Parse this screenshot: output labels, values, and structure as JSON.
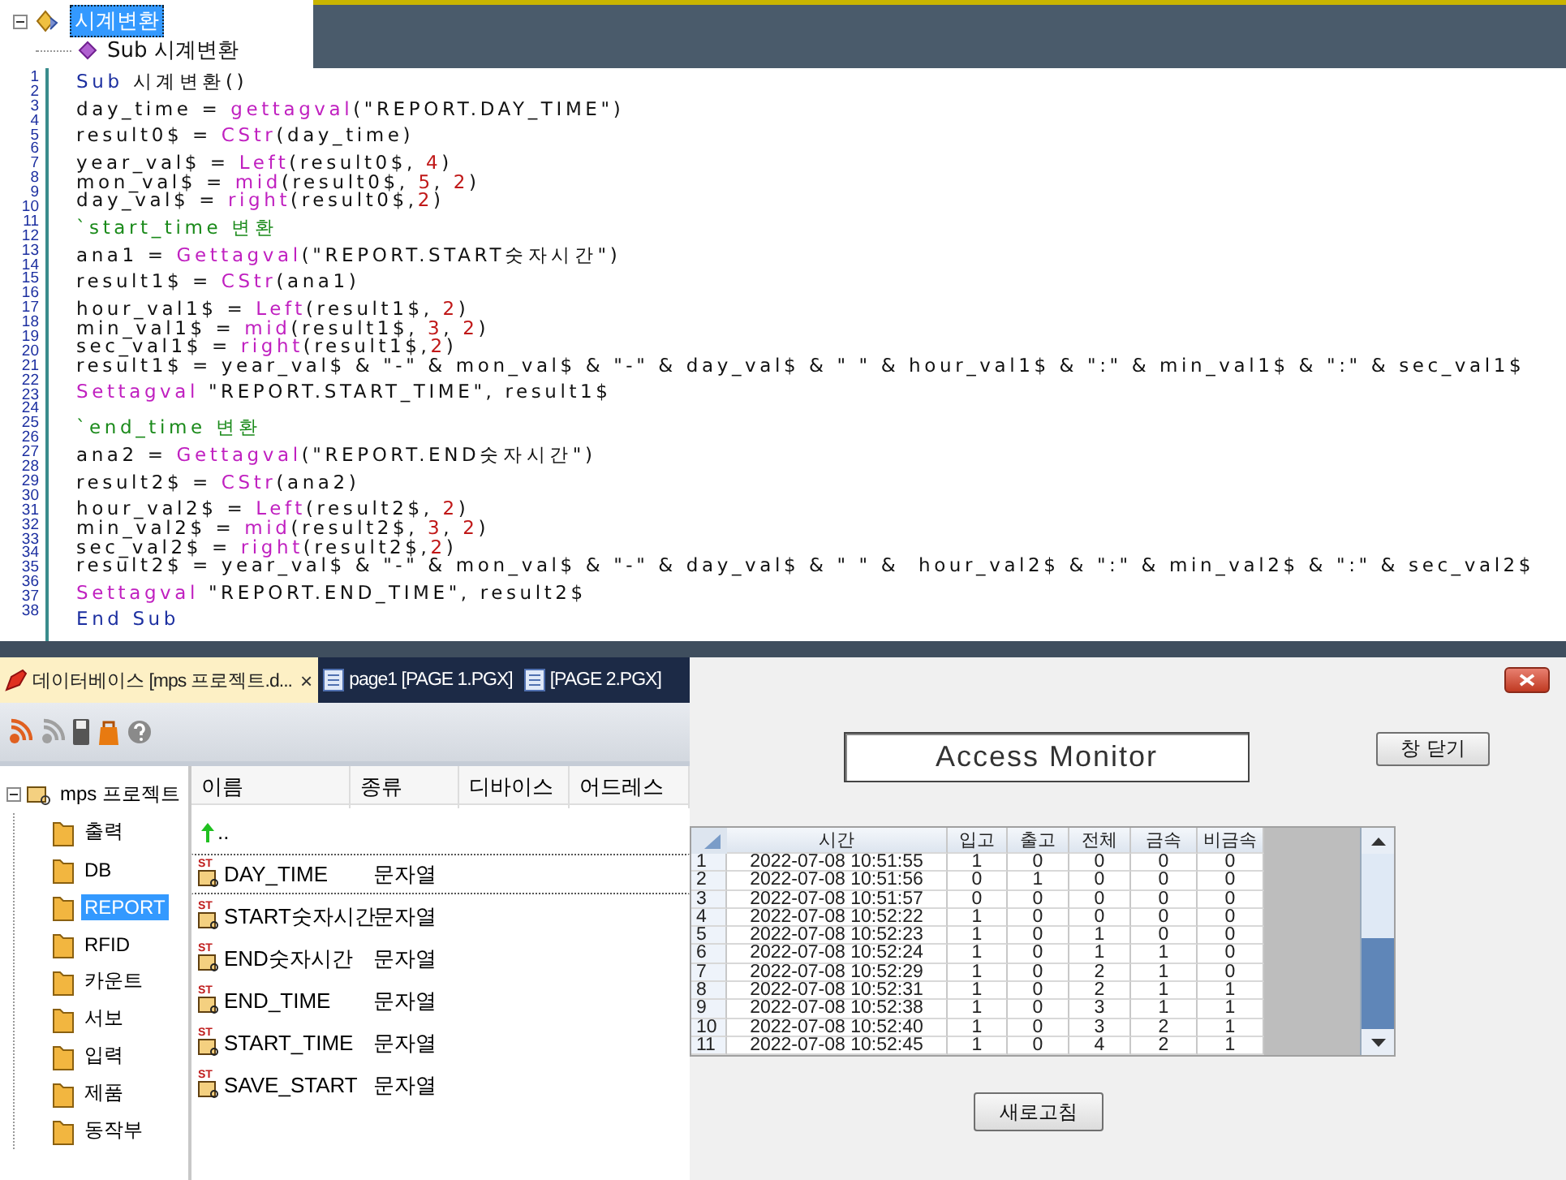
{
  "outline": {
    "items": [
      {
        "label": "시계변환",
        "selected": true,
        "expanded": true,
        "children": [
          {
            "label": "Sub 시계변환",
            "selected": false
          }
        ]
      }
    ]
  },
  "code": {
    "lines": [
      {
        "number": "1",
        "segments": [
          {
            "kind": "keyword",
            "text": "Sub"
          },
          {
            "kind": "plain",
            "text": " 시계변환()"
          }
        ]
      },
      {
        "number": "2"
      },
      {
        "number": "3",
        "segments": [
          {
            "kind": "plain",
            "text": "day_time = "
          },
          {
            "kind": "function",
            "text": "gettagval"
          },
          {
            "kind": "plain",
            "text": "(\"REPORT.DAY_TIME\")"
          }
        ]
      },
      {
        "number": "4"
      },
      {
        "number": "5",
        "segments": [
          {
            "kind": "plain",
            "text": "result0$ = "
          },
          {
            "kind": "function",
            "text": "CStr"
          },
          {
            "kind": "plain",
            "text": "(day_time)"
          }
        ]
      },
      {
        "number": "6"
      },
      {
        "number": "7",
        "segments": [
          {
            "kind": "plain",
            "text": "year_val$ = "
          },
          {
            "kind": "function",
            "text": "Left"
          },
          {
            "kind": "plain",
            "text": "(result0$, "
          },
          {
            "kind": "number",
            "text": "4"
          },
          {
            "kind": "plain",
            "text": ")"
          }
        ]
      },
      {
        "number": "8",
        "segments": [
          {
            "kind": "plain",
            "text": "mon_val$ = "
          },
          {
            "kind": "function",
            "text": "mid"
          },
          {
            "kind": "plain",
            "text": "(result0$, "
          },
          {
            "kind": "number",
            "text": "5"
          },
          {
            "kind": "plain",
            "text": ", "
          },
          {
            "kind": "number",
            "text": "2"
          },
          {
            "kind": "plain",
            "text": ")"
          }
        ]
      },
      {
        "number": "9",
        "segments": [
          {
            "kind": "plain",
            "text": "day_val$ = "
          },
          {
            "kind": "function",
            "text": "right"
          },
          {
            "kind": "plain",
            "text": "(result0$,"
          },
          {
            "kind": "number",
            "text": "2"
          },
          {
            "kind": "plain",
            "text": ")"
          }
        ]
      },
      {
        "number": "10"
      },
      {
        "number": "11",
        "segments": [
          {
            "kind": "comment",
            "text": "`start_time 변환"
          }
        ]
      },
      {
        "number": "12"
      },
      {
        "number": "13",
        "segments": [
          {
            "kind": "plain",
            "text": "ana1 = "
          },
          {
            "kind": "function",
            "text": "Gettagval"
          },
          {
            "kind": "plain",
            "text": "(\"REPORT.START숫자시간\")"
          }
        ]
      },
      {
        "number": "14"
      },
      {
        "number": "15",
        "segments": [
          {
            "kind": "plain",
            "text": "result1$ = "
          },
          {
            "kind": "function",
            "text": "CStr"
          },
          {
            "kind": "plain",
            "text": "(ana1)"
          }
        ]
      },
      {
        "number": "16"
      },
      {
        "number": "17",
        "segments": [
          {
            "kind": "plain",
            "text": "hour_val1$ = "
          },
          {
            "kind": "function",
            "text": "Left"
          },
          {
            "kind": "plain",
            "text": "(result1$, "
          },
          {
            "kind": "number",
            "text": "2"
          },
          {
            "kind": "plain",
            "text": ")"
          }
        ]
      },
      {
        "number": "18",
        "segments": [
          {
            "kind": "plain",
            "text": "min_val1$ = "
          },
          {
            "kind": "function",
            "text": "mid"
          },
          {
            "kind": "plain",
            "text": "(result1$, "
          },
          {
            "kind": "number",
            "text": "3"
          },
          {
            "kind": "plain",
            "text": ", "
          },
          {
            "kind": "number",
            "text": "2"
          },
          {
            "kind": "plain",
            "text": ")"
          }
        ]
      },
      {
        "number": "19",
        "segments": [
          {
            "kind": "plain",
            "text": "sec_val1$ = "
          },
          {
            "kind": "function",
            "text": "right"
          },
          {
            "kind": "plain",
            "text": "(result1$,"
          },
          {
            "kind": "number",
            "text": "2"
          },
          {
            "kind": "plain",
            "text": ")"
          }
        ]
      },
      {
        "number": "20",
        "segments": [
          {
            "kind": "plain",
            "text": "result1$ = year_val$ & \"-\" & mon_val$ & \"-\" & day_val$ & \" \" & hour_val1$ & \":\" & min_val1$ & \":\" & sec_val1$"
          }
        ]
      },
      {
        "number": "21"
      },
      {
        "number": "22",
        "segments": [
          {
            "kind": "function",
            "text": "Settagval"
          },
          {
            "kind": "plain",
            "text": " \"REPORT.START_TIME\", result1$"
          }
        ]
      },
      {
        "number": "23"
      },
      {
        "number": "24"
      },
      {
        "number": "25",
        "segments": [
          {
            "kind": "comment",
            "text": "`end_time 변환"
          }
        ]
      },
      {
        "number": "26"
      },
      {
        "number": "27",
        "segments": [
          {
            "kind": "plain",
            "text": "ana2 = "
          },
          {
            "kind": "function",
            "text": "Gettagval"
          },
          {
            "kind": "plain",
            "text": "(\"REPORT.END숫자시간\")"
          }
        ]
      },
      {
        "number": "28"
      },
      {
        "number": "29",
        "segments": [
          {
            "kind": "plain",
            "text": "result2$ = "
          },
          {
            "kind": "function",
            "text": "CStr"
          },
          {
            "kind": "plain",
            "text": "(ana2)"
          }
        ]
      },
      {
        "number": "30"
      },
      {
        "number": "31",
        "segments": [
          {
            "kind": "plain",
            "text": "hour_val2$ = "
          },
          {
            "kind": "function",
            "text": "Left"
          },
          {
            "kind": "plain",
            "text": "(result2$, "
          },
          {
            "kind": "number",
            "text": "2"
          },
          {
            "kind": "plain",
            "text": ")"
          }
        ]
      },
      {
        "number": "32",
        "segments": [
          {
            "kind": "plain",
            "text": "min_val2$ = "
          },
          {
            "kind": "function",
            "text": "mid"
          },
          {
            "kind": "plain",
            "text": "(result2$, "
          },
          {
            "kind": "number",
            "text": "3"
          },
          {
            "kind": "plain",
            "text": ", "
          },
          {
            "kind": "number",
            "text": "2"
          },
          {
            "kind": "plain",
            "text": ")"
          }
        ]
      },
      {
        "number": "33",
        "segments": [
          {
            "kind": "plain",
            "text": "sec_val2$ = "
          },
          {
            "kind": "function",
            "text": "right"
          },
          {
            "kind": "plain",
            "text": "(result2$,"
          },
          {
            "kind": "number",
            "text": "2"
          },
          {
            "kind": "plain",
            "text": ")"
          }
        ]
      },
      {
        "number": "34",
        "segments": [
          {
            "kind": "plain",
            "text": "result2$ = year_val$ & \"-\" & mon_val$ & \"-\" & day_val$ & \" \" &  hour_val2$ & \":\" & min_val2$ & \":\" & sec_val2$"
          }
        ]
      },
      {
        "number": "35"
      },
      {
        "number": "36",
        "segments": [
          {
            "kind": "function",
            "text": "Settagval"
          },
          {
            "kind": "plain",
            "text": " \"REPORT.END_TIME\", result2$"
          }
        ]
      },
      {
        "number": "37"
      },
      {
        "number": "38",
        "segments": [
          {
            "kind": "keyword",
            "text": "End Sub"
          }
        ]
      }
    ]
  },
  "tabs": [
    {
      "label": "데이터베이스 [mps 프로젝트.d...",
      "selected": true,
      "close": "×"
    },
    {
      "label": "page1 [PAGE 1.PGX]",
      "selected": false
    },
    {
      "label": "[PAGE 2.PGX]",
      "selected": false
    }
  ],
  "project_tree": {
    "label": "mps 프로젝트",
    "expanded": true,
    "children": [
      {
        "label": "출력",
        "selected": false
      },
      {
        "label": "DB",
        "selected": false
      },
      {
        "label": "REPORT",
        "selected": true
      },
      {
        "label": "RFID",
        "selected": false
      },
      {
        "label": "카운트",
        "selected": false
      },
      {
        "label": "서보",
        "selected": false
      },
      {
        "label": "입력",
        "selected": false
      },
      {
        "label": "제품",
        "selected": false
      },
      {
        "label": "동작부",
        "selected": false
      }
    ]
  },
  "tag_list": {
    "columns": [
      "이름",
      "종류",
      "디바이스",
      "어드레스"
    ],
    "parent_row": "..",
    "rows": [
      {
        "badge": "ST",
        "name": "DAY_TIME",
        "type": "문자열",
        "focused": true
      },
      {
        "badge": "ST",
        "name": "START숫자시간",
        "type": "문자열",
        "focused": false
      },
      {
        "badge": "ST",
        "name": "END숫자시간",
        "type": "문자열",
        "focused": false
      },
      {
        "badge": "ST",
        "name": "END_TIME",
        "type": "문자열",
        "focused": false
      },
      {
        "badge": "ST",
        "name": "START_TIME",
        "type": "문자열",
        "focused": false
      },
      {
        "badge": "ST",
        "name": "SAVE_START",
        "type": "문자열",
        "focused": false
      }
    ]
  },
  "monitor": {
    "title": "Access Monitor",
    "close_button": "창 닫기",
    "refresh_button": "새로고침",
    "table": {
      "columns": [
        "시간",
        "입고",
        "출고",
        "전체",
        "금속",
        "비금속"
      ],
      "rows": [
        {
          "index": "1",
          "cells": [
            "2022-07-08 10:51:55",
            "1",
            "0",
            "0",
            "0",
            "0"
          ]
        },
        {
          "index": "2",
          "cells": [
            "2022-07-08 10:51:56",
            "0",
            "1",
            "0",
            "0",
            "0"
          ]
        },
        {
          "index": "3",
          "cells": [
            "2022-07-08 10:51:57",
            "0",
            "0",
            "0",
            "0",
            "0"
          ]
        },
        {
          "index": "4",
          "cells": [
            "2022-07-08 10:52:22",
            "1",
            "0",
            "0",
            "0",
            "0"
          ]
        },
        {
          "index": "5",
          "cells": [
            "2022-07-08 10:52:23",
            "1",
            "0",
            "1",
            "0",
            "0"
          ]
        },
        {
          "index": "6",
          "cells": [
            "2022-07-08 10:52:24",
            "1",
            "0",
            "1",
            "1",
            "0"
          ]
        },
        {
          "index": "7",
          "cells": [
            "2022-07-08 10:52:29",
            "1",
            "0",
            "2",
            "1",
            "0"
          ]
        },
        {
          "index": "8",
          "cells": [
            "2022-07-08 10:52:31",
            "1",
            "0",
            "2",
            "1",
            "1"
          ]
        },
        {
          "index": "9",
          "cells": [
            "2022-07-08 10:52:38",
            "1",
            "0",
            "3",
            "1",
            "1"
          ]
        },
        {
          "index": "10",
          "cells": [
            "2022-07-08 10:52:40",
            "1",
            "0",
            "3",
            "2",
            "1"
          ]
        },
        {
          "index": "11",
          "cells": [
            "2022-07-08 10:52:45",
            "1",
            "0",
            "4",
            "2",
            "1"
          ]
        }
      ]
    }
  }
}
